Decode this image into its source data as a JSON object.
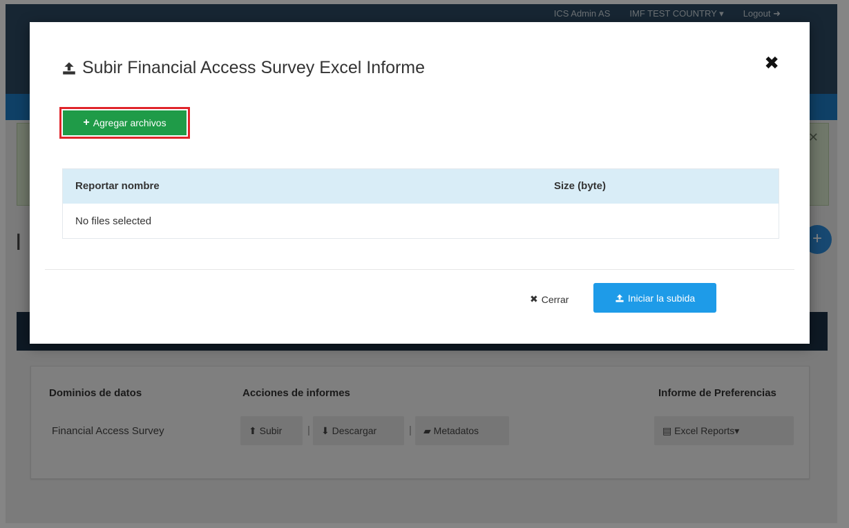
{
  "header": {
    "user": "ICS Admin AS",
    "country": "IMF TEST COUNTRY",
    "logout": "Logout"
  },
  "page": {
    "title_fragment": "I",
    "panel": {
      "col_domains": "Dominios de datos",
      "col_actions": "Acciones de informes",
      "col_prefs": "Informe de Preferencias",
      "row_domain": "Financial Access Survey",
      "btn_upload": "Subir",
      "btn_download": "Descargar",
      "btn_metadata": "Metadatos",
      "btn_excel": "Excel Reports"
    }
  },
  "modal": {
    "title": "Subir Financial Access Survey Excel Informe",
    "add_files": "Agregar archivos",
    "table": {
      "col_name": "Reportar nombre",
      "col_size": "Size (byte)",
      "empty": "No files selected"
    },
    "cancel": "Cerrar",
    "start_upload": "Iniciar la subida"
  },
  "colors": {
    "add_button": "#1f9b48",
    "highlight_border": "#e0242a",
    "primary_button": "#1e9be8",
    "table_header": "#d9edf7"
  }
}
